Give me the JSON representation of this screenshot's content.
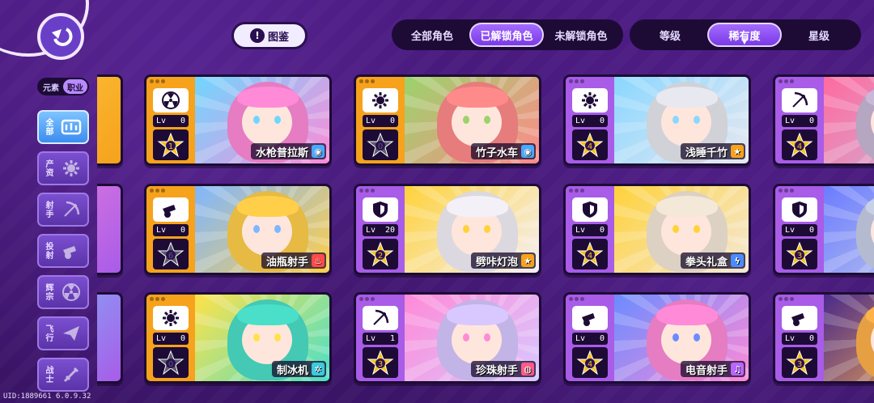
{
  "header": {
    "guide_label": "图鉴",
    "filter_options": [
      "全部角色",
      "已解锁角色",
      "未解锁角色"
    ],
    "filter_active": 1,
    "sort_options": [
      "等级",
      "稀有度",
      "星级"
    ],
    "sort_active": 1
  },
  "side": {
    "toggle": [
      "元素",
      "职业"
    ],
    "toggle_active": 1,
    "categories": [
      {
        "label": "全部",
        "icon": "all-icon",
        "active": true
      },
      {
        "label": "产资",
        "icon": "gear-icon",
        "active": false
      },
      {
        "label": "射手",
        "icon": "bow-icon",
        "active": false
      },
      {
        "label": "投射",
        "icon": "cannon-icon",
        "active": false
      },
      {
        "label": "辉宗",
        "icon": "radiation-icon",
        "active": false
      },
      {
        "label": "飞行",
        "icon": "paper-plane-icon",
        "active": false
      },
      {
        "label": "战士",
        "icon": "sword-icon",
        "active": false
      }
    ]
  },
  "cards": [
    {
      "name": "水枪普拉斯",
      "level": "0",
      "star": "1",
      "class_icon": "radiation-icon",
      "element_icon": "water-icon",
      "tier": "orange",
      "art": [
        "#ff8ad8",
        "#6fd6ff"
      ],
      "elem_color": "#4aa8ff"
    },
    {
      "name": "竹子水车",
      "level": "0",
      "star": "0",
      "class_icon": "gear-icon",
      "element_icon": "water-icon",
      "tier": "orange",
      "art": [
        "#ff8a8a",
        "#9bd36b"
      ],
      "elem_color": "#4aa8ff"
    },
    {
      "name": "浅睡千竹",
      "level": "0",
      "star": "4",
      "class_icon": "gear-icon",
      "element_icon": "star-icon",
      "tier": "purple",
      "art": [
        "#e8e8f0",
        "#8ad7ff"
      ],
      "elem_color": "#f6a21c"
    },
    {
      "name": "",
      "level": "0",
      "star": "4",
      "class_icon": "bow-icon",
      "element_icon": "",
      "tier": "purple",
      "art": [
        "#c9b8d8",
        "#ff6aa0"
      ],
      "elem_color": "#a85ce8"
    },
    {
      "name": "油瓶射手",
      "level": "0",
      "star": "6",
      "class_icon": "cannon-icon",
      "element_icon": "fire-icon",
      "tier": "orange",
      "art": [
        "#ffcf4a",
        "#7fb6ff"
      ],
      "elem_color": "#ff4a4a"
    },
    {
      "name": "劈咔灯泡",
      "level": "20",
      "star": "2",
      "class_icon": "shield-icon",
      "element_icon": "star-icon",
      "tier": "purple",
      "art": [
        "#f4f0f8",
        "#ffd23a"
      ],
      "elem_color": "#f6a21c"
    },
    {
      "name": "拳头礼盒",
      "level": "0",
      "star": "4",
      "class_icon": "shield-icon",
      "element_icon": "lightning-icon",
      "tier": "purple",
      "art": [
        "#f4e8d8",
        "#ffd23a"
      ],
      "elem_color": "#4a8cff"
    },
    {
      "name": "",
      "level": "0",
      "star": "3",
      "class_icon": "shield-icon",
      "element_icon": "",
      "tier": "purple",
      "art": [
        "#c8d0e8",
        "#6b7cff"
      ],
      "elem_color": "#a85ce8"
    },
    {
      "name": "制冰机",
      "level": "0",
      "star": "0",
      "class_icon": "gear-icon",
      "element_icon": "ice-icon",
      "tier": "orange",
      "art": [
        "#4adfc8",
        "#ffe24a"
      ],
      "elem_color": "#3acbe0"
    },
    {
      "name": "珍珠射手",
      "level": "1",
      "star": "3",
      "class_icon": "bow-icon",
      "element_icon": "cake-icon",
      "tier": "purple",
      "art": [
        "#d8c8ff",
        "#ff8ad8"
      ],
      "elem_color": "#ff5a8a"
    },
    {
      "name": "电音射手",
      "level": "0",
      "star": "4",
      "class_icon": "cannon-icon",
      "element_icon": "music-icon",
      "tier": "purple",
      "art": [
        "#ff8ad8",
        "#6b8cff"
      ],
      "elem_color": "#b866ff"
    },
    {
      "name": "",
      "level": "0",
      "star": "3",
      "class_icon": "cannon-icon",
      "element_icon": "",
      "tier": "purple",
      "art": [
        "#ffb24a",
        "#4a2a8a"
      ],
      "elem_color": "#a85ce8"
    }
  ],
  "lv_prefix": "Lv",
  "uid": "UID:1889661 6.0.9.32"
}
